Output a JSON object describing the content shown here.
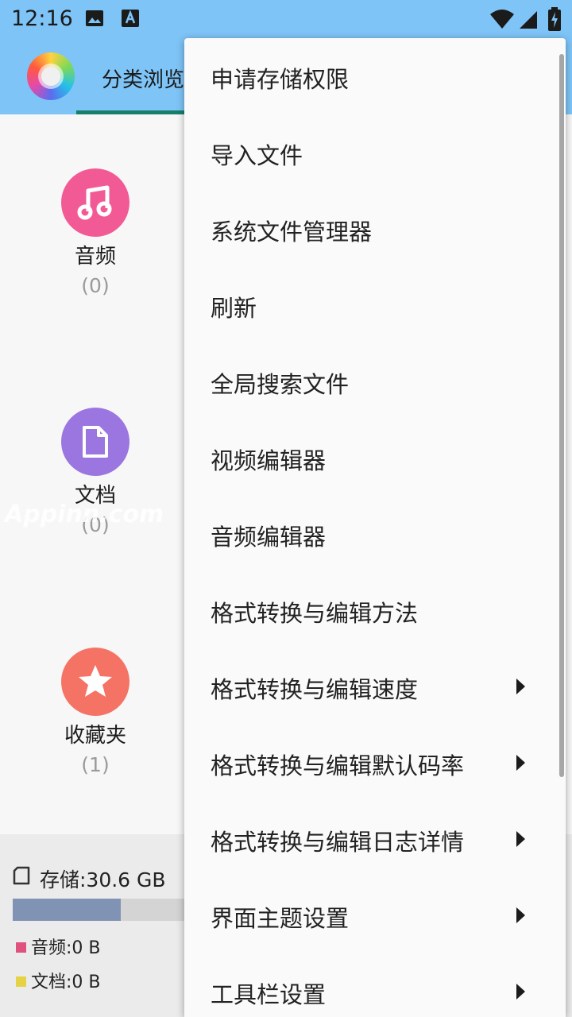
{
  "status_bar": {
    "time": "12:16",
    "icons": [
      "image-icon",
      "a-text-icon",
      "wifi-icon",
      "signal-icon",
      "battery-charging-icon"
    ]
  },
  "app_bar": {
    "logo": "app-logo-icon",
    "tab_label": "分类浏览"
  },
  "categories": [
    {
      "name": "音频",
      "count": "(0)",
      "icon": "music-note-icon",
      "color": "#f25a96"
    },
    {
      "name": "文档",
      "count": "(0)",
      "icon": "document-icon",
      "color": "#9b76e0"
    },
    {
      "name": "收藏夹",
      "count": "(1)",
      "icon": "star-icon",
      "color": "#f57365"
    }
  ],
  "watermark": "Appinn.com",
  "storage": {
    "icon": "sd-card-icon",
    "label": "存储:30.6 GB",
    "used_fraction": 0.2,
    "legend": [
      {
        "label": "音频:0 B",
        "color": "#e0527e"
      },
      {
        "label": "文档:0 B",
        "color": "#e6d245"
      }
    ]
  },
  "menu": {
    "items": [
      {
        "label": "申请存储权限",
        "submenu": false
      },
      {
        "label": "导入文件",
        "submenu": false
      },
      {
        "label": "系统文件管理器",
        "submenu": false
      },
      {
        "label": "刷新",
        "submenu": false
      },
      {
        "label": "全局搜索文件",
        "submenu": false
      },
      {
        "label": "视频编辑器",
        "submenu": false
      },
      {
        "label": "音频编辑器",
        "submenu": false
      },
      {
        "label": "格式转换与编辑方法",
        "submenu": false
      },
      {
        "label": "格式转换与编辑速度",
        "submenu": true
      },
      {
        "label": "格式转换与编辑默认码率",
        "submenu": true
      },
      {
        "label": "格式转换与编辑日志详情",
        "submenu": true
      },
      {
        "label": "界面主题设置",
        "submenu": true
      },
      {
        "label": "工具栏设置",
        "submenu": true
      }
    ]
  }
}
